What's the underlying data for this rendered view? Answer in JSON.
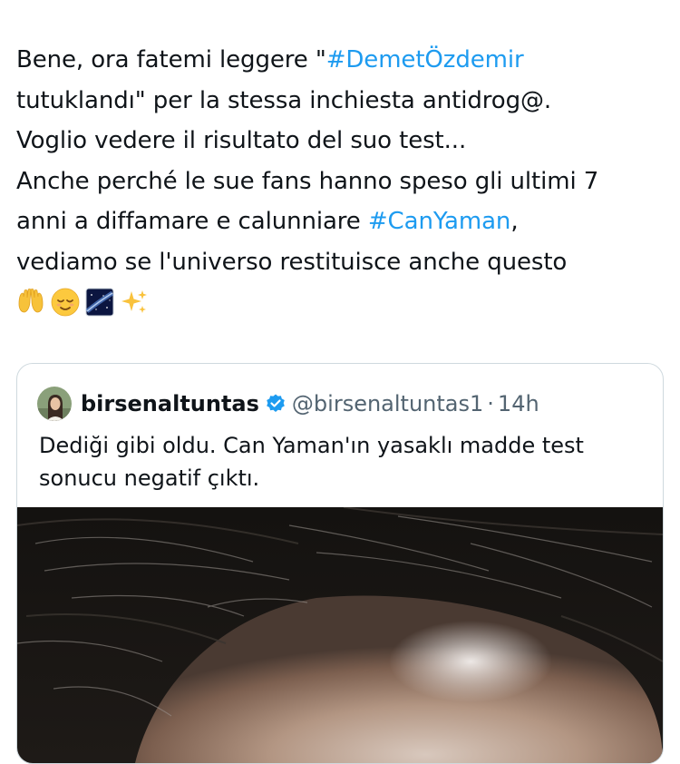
{
  "tweet": {
    "line1_prefix": "Bene, ora fatemi leggere \"",
    "hashtag_demet": "#DemetÖzdemir",
    "line2": "tutuklandı\" per la stessa inchiesta antidrog@.",
    "line3": "Voglio vedere il risultato del suo test...",
    "line4": "Anche perché le sue fans hanno speso gli ultimi 7",
    "line5_prefix": "anni a diffamare e calunniare ",
    "hashtag_can": "#CanYaman",
    "line5_suffix": ",",
    "line6": "vediamo se l'universo restituisce anche questo",
    "emojis": [
      "raising-hands-emoji",
      "relieved-face-emoji",
      "milky-way-emoji",
      "sparkles-emoji"
    ],
    "hashtag_color": "#1d9bf0"
  },
  "quote": {
    "display_name": "birsenaltuntas",
    "verified_icon": "verified-badge-icon",
    "handle": "@birsenaltuntas1",
    "separator": "·",
    "time": "14h",
    "text_line1": "Dediği gibi oldu. Can Yaman'ın yasaklı madde test",
    "text_line2": "sonucu negatif çıktı.",
    "media_icon": "photo-of-hairline",
    "verified_color": "#1d9bf0"
  }
}
